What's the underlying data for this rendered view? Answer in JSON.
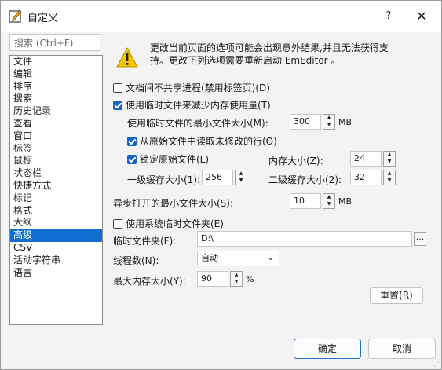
{
  "window": {
    "title": "自定义",
    "help_label": "?",
    "close_label": "✕"
  },
  "search": {
    "placeholder": "搜索 (Ctrl+F)"
  },
  "categories": [
    {
      "label": "文件"
    },
    {
      "label": "编辑"
    },
    {
      "label": "排序"
    },
    {
      "label": "搜索"
    },
    {
      "label": "历史记录"
    },
    {
      "label": "查看"
    },
    {
      "label": "窗口"
    },
    {
      "label": "标签"
    },
    {
      "label": "鼠标"
    },
    {
      "label": "状态栏"
    },
    {
      "label": "快捷方式"
    },
    {
      "label": "标记"
    },
    {
      "label": "格式"
    },
    {
      "label": "大纲"
    },
    {
      "label": "高级",
      "selected": true
    },
    {
      "label": "CSV"
    },
    {
      "label": "活动字符串"
    },
    {
      "label": "语言"
    }
  ],
  "warning": {
    "line1": "更改当前页面的选项可能会出现意外结果,并且无法获得支",
    "line2": "持。更改下列选项需要重新启动 EmEditor 。"
  },
  "options": {
    "no_shared_process": {
      "label": "文档间不共享进程(禁用标签页)(D)",
      "checked": false
    },
    "use_temp_files": {
      "label": "使用临时文件来减少内存使用量(T)",
      "checked": true
    },
    "min_file_size_label": "使用临时文件的最小文件大小(M):",
    "min_file_size_value": "300",
    "min_file_size_unit": "MB",
    "read_unmodified": {
      "label": "从原始文件中读取未修改的行(O)",
      "checked": true
    },
    "lock_original": {
      "label": "锁定原始文件(L)",
      "checked": true
    },
    "memory_size_label": "内存大小(Z):",
    "memory_size_value": "24",
    "l1_cache_label": "一级缓存大小(1):",
    "l1_cache_value": "256",
    "l2_cache_label": "二级缓存大小(2):",
    "l2_cache_value": "32",
    "async_min_label": "异步打开的最小文件大小(S):",
    "async_min_value": "10",
    "async_min_unit": "MB",
    "use_system_temp": {
      "label": "使用系统临时文件夹(E)",
      "checked": false
    },
    "temp_folder_label": "临时文件夹(F):",
    "temp_folder_value": "D:\\",
    "browse_label": "...",
    "threads_label": "线程数(N):",
    "threads_value": "自动",
    "max_memory_label": "最大内存大小(Y):",
    "max_memory_value": "90",
    "max_memory_unit": "%",
    "reset_label": "重置(R)"
  },
  "footer": {
    "ok_label": "确定",
    "cancel_label": "取消"
  }
}
